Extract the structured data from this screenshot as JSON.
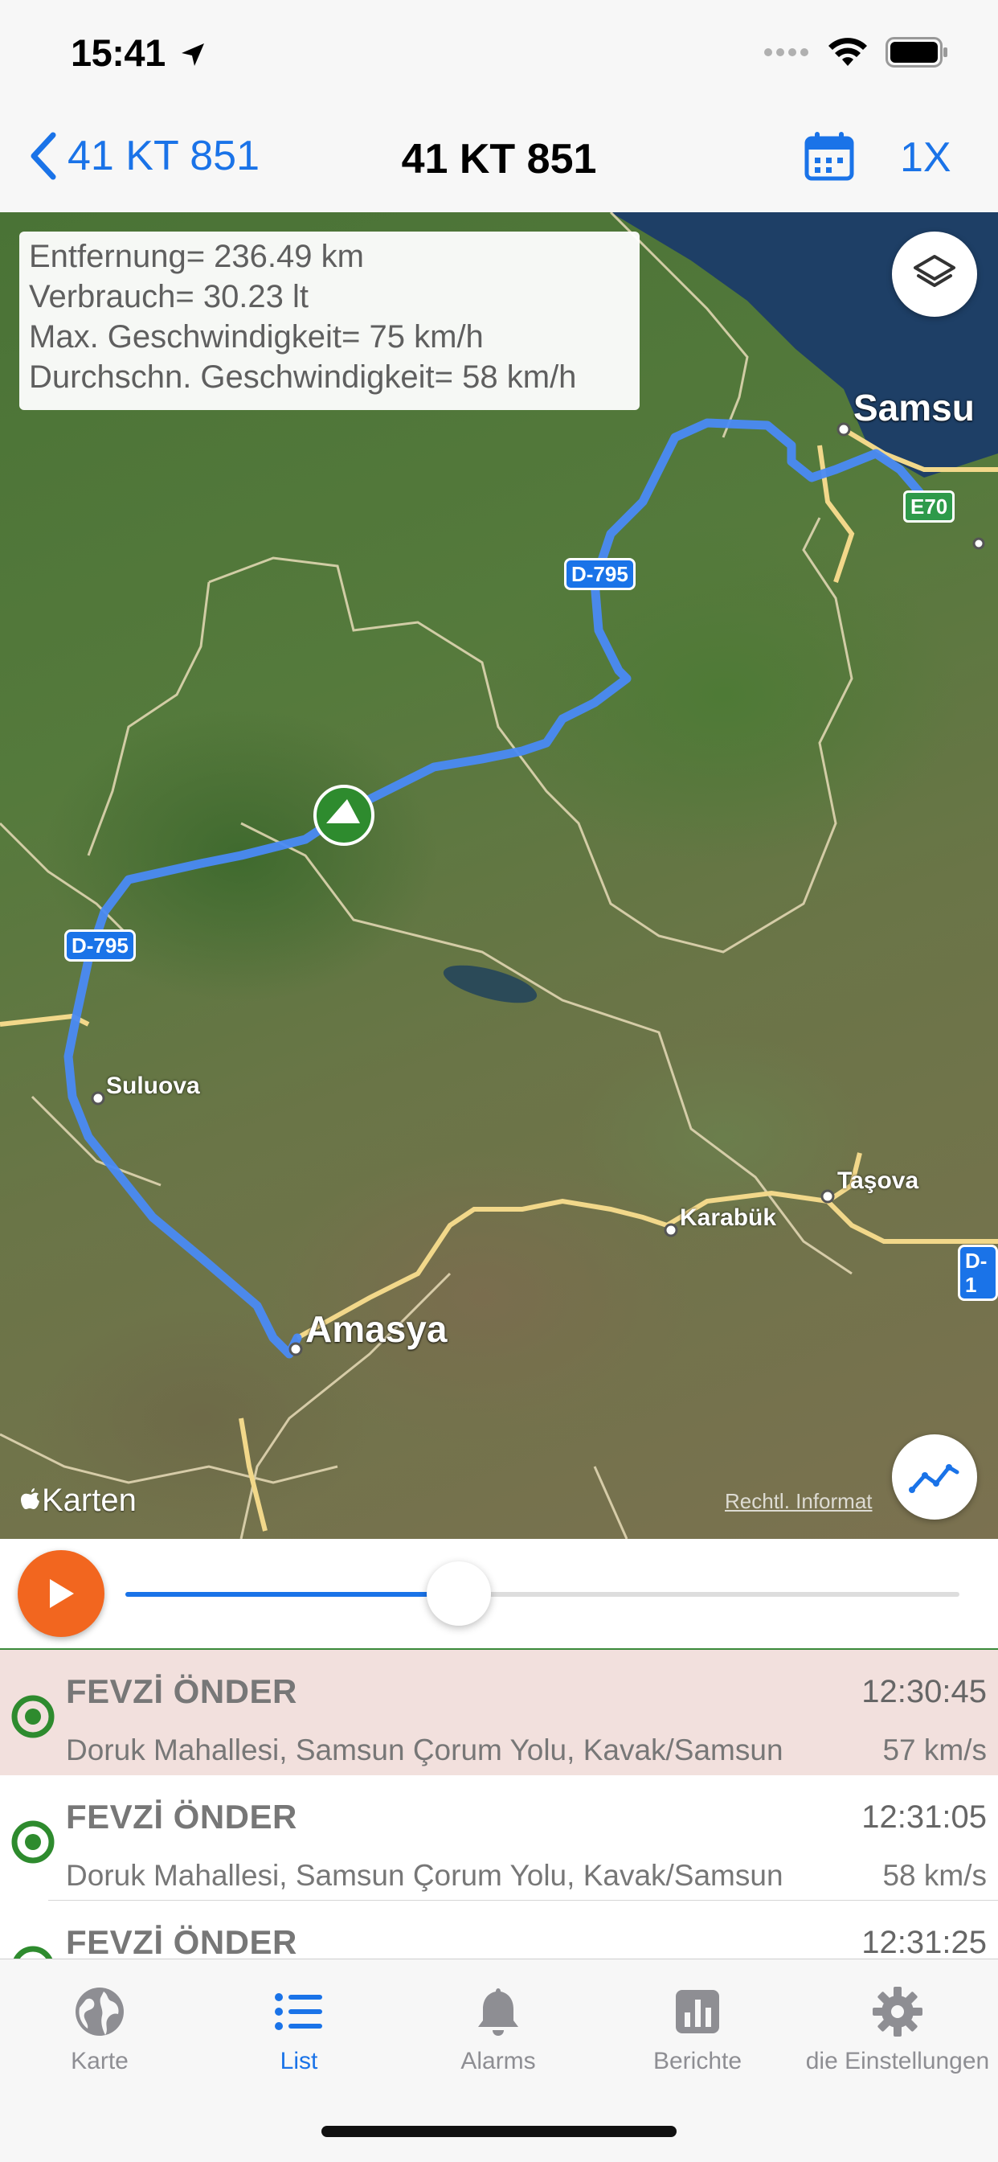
{
  "status_bar": {
    "time": "15:41"
  },
  "nav": {
    "back_label": "41 KT 851",
    "title": "41 KT 851",
    "speed_label": "1X"
  },
  "stats": {
    "distance": "Entfernung= 236.49 km",
    "consumption": "Verbrauch= 30.23 lt",
    "max_speed": "Max. Geschwindigkeit= 75 km/h",
    "avg_speed": "Durchschn. Geschwindigkeit= 58 km/h"
  },
  "map": {
    "cities": {
      "samsun": "Samsu",
      "amasya": "Amasya"
    },
    "towns": {
      "suluova": "Suluova",
      "karabuk": "Karabük",
      "tasova": "Taşova"
    },
    "road_shields": {
      "d795_north": "D-795",
      "d795_west": "D-795",
      "e70": "E70",
      "d1": "D-1"
    },
    "attribution": "Karten",
    "legal": "Rechtl. Informat",
    "route_color": "#4a8af4"
  },
  "playback": {
    "progress": 0.4
  },
  "list": {
    "rows": [
      {
        "name": "FEVZİ ÖNDER",
        "time": "12:30:45",
        "address": "Doruk Mahallesi, Samsun Çorum Yolu, Kavak/Samsun",
        "speed": "57 km/s"
      },
      {
        "name": "FEVZİ ÖNDER",
        "time": "12:31:05",
        "address": "Doruk Mahallesi, Samsun Çorum Yolu, Kavak/Samsun",
        "speed": "58 km/s"
      },
      {
        "name": "FEVZİ ÖNDER",
        "time": "12:31:25",
        "address": "",
        "speed": ""
      }
    ]
  },
  "tabs": [
    {
      "label": "Karte",
      "icon": "globe-icon"
    },
    {
      "label": "List",
      "icon": "list-icon"
    },
    {
      "label": "Alarms",
      "icon": "bell-icon"
    },
    {
      "label": "Berichte",
      "icon": "bar-chart-icon"
    },
    {
      "label": "die Einstellungen",
      "icon": "gear-icon"
    }
  ],
  "colors": {
    "accent": "#1a73e8",
    "play": "#f2661f",
    "selected_row": "#f2e0dd",
    "status_green": "#2e8b2e"
  }
}
